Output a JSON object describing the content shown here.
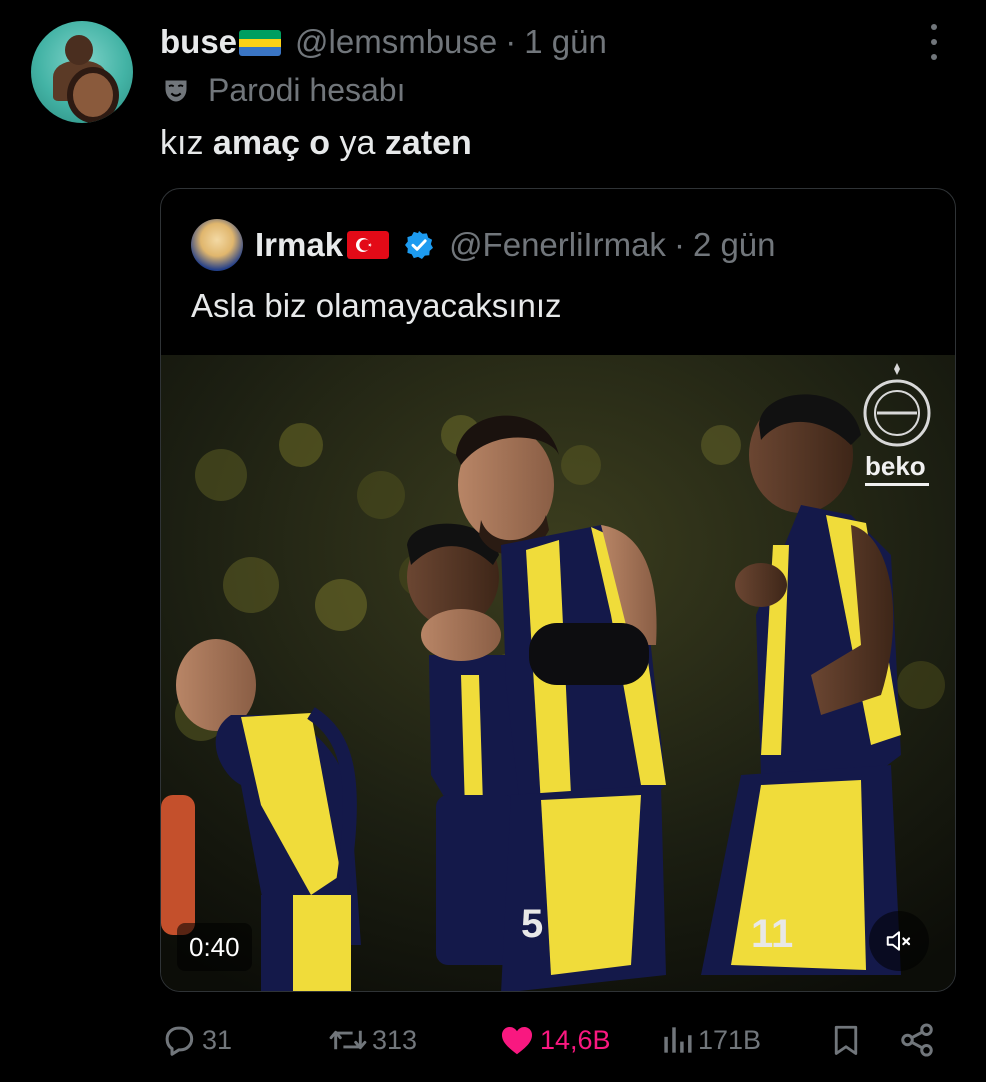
{
  "tweet": {
    "author_name": "buse",
    "author_handle": "@lemsmbuse",
    "separator": "·",
    "time": "1 gün",
    "parody_label": "Parodi hesabı",
    "text_parts": [
      {
        "text": "kız ",
        "bold": false
      },
      {
        "text": "amaç o",
        "bold": true
      },
      {
        "text": " ya ",
        "bold": false
      },
      {
        "text": "zaten",
        "bold": true
      }
    ]
  },
  "quote": {
    "author_name": "Irmak",
    "author_handle": "@FenerliIrmak",
    "separator": "·",
    "time": "2 gün",
    "text": "Asla biz olamayacaksınız",
    "media": {
      "duration": "0:40",
      "watermark": "beko",
      "jersey_numbers": [
        "5",
        "11"
      ]
    }
  },
  "actions": {
    "replies": "31",
    "retweets": "313",
    "likes": "14,6B",
    "views": "171B"
  },
  "colors": {
    "background": "#000000",
    "text": "#e7e9ea",
    "muted": "#71767b",
    "like_pink": "#f91880",
    "verified_blue": "#1d9bf0",
    "border": "#2f3336"
  },
  "icons": [
    "more-icon",
    "parody-mask-icon",
    "verified-badge-icon",
    "mute-icon",
    "reply-icon",
    "retweet-icon",
    "like-icon",
    "views-icon",
    "bookmark-icon",
    "share-icon"
  ]
}
